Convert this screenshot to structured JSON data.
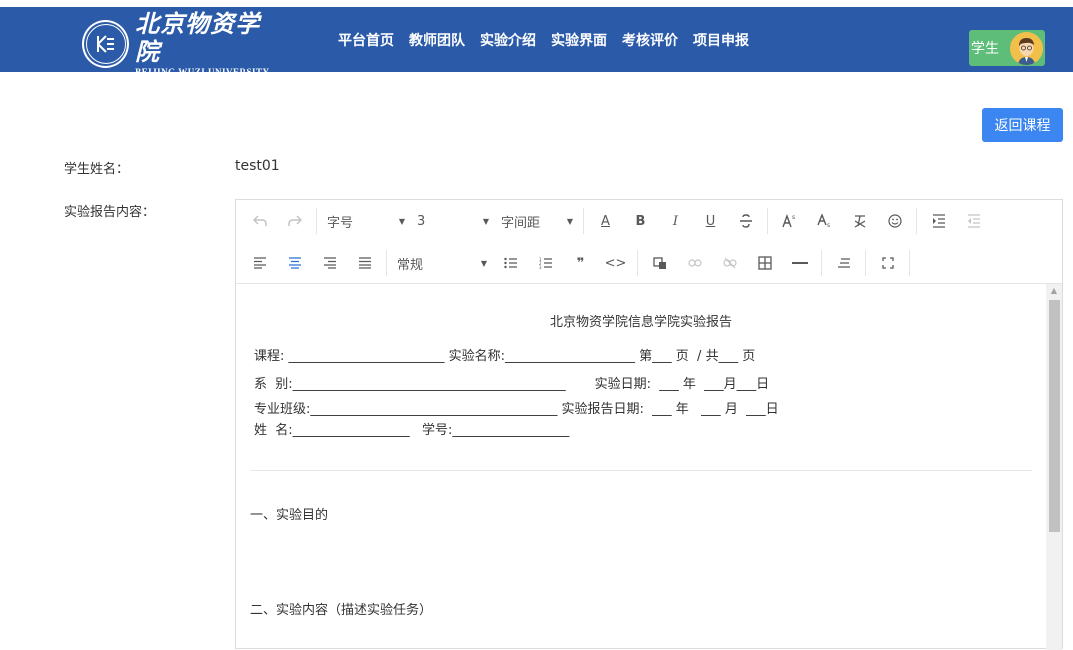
{
  "header": {
    "logo_cn": "北京物资学院",
    "logo_en": "BEIJING WUZI UNIVERSITY",
    "nav": [
      "平台首页",
      "教师团队",
      "实验介绍",
      "实验界面",
      "考核评价",
      "项目申报"
    ],
    "user_label": "学生",
    "colors": {
      "bar": "#2a5aa8",
      "badge": "#5fbd7a",
      "button": "#3b86f0"
    }
  },
  "actions": {
    "back_label": "返回课程"
  },
  "form": {
    "student_label": "学生姓名：",
    "student_value": "test01",
    "report_label": "实验报告内容："
  },
  "toolbar": {
    "font_size_label": "字号",
    "line_height_value": "3",
    "letter_spacing_label": "字间距",
    "paragraph_label": "常规",
    "bold": "B",
    "italic": "I",
    "underline": "U",
    "font_color": "A",
    "quote": "❞",
    "code": "<>"
  },
  "document": {
    "title": "北京物资学院信息学院实验报告",
    "lines": [
      "课程: ________________________ 实验名称:____________________ 第___ 页  / 共___ 页",
      "系  别:__________________________________________       实验日期:  ___ 年  ___月___日",
      "专业班级:______________________________________ 实验报告日期:  ___ 年   ___ 月  ___日",
      "姓  名:__________________   学号:__________________"
    ],
    "sections": [
      "一、实验目的",
      "二、实验内容（描述实验任务）"
    ]
  }
}
